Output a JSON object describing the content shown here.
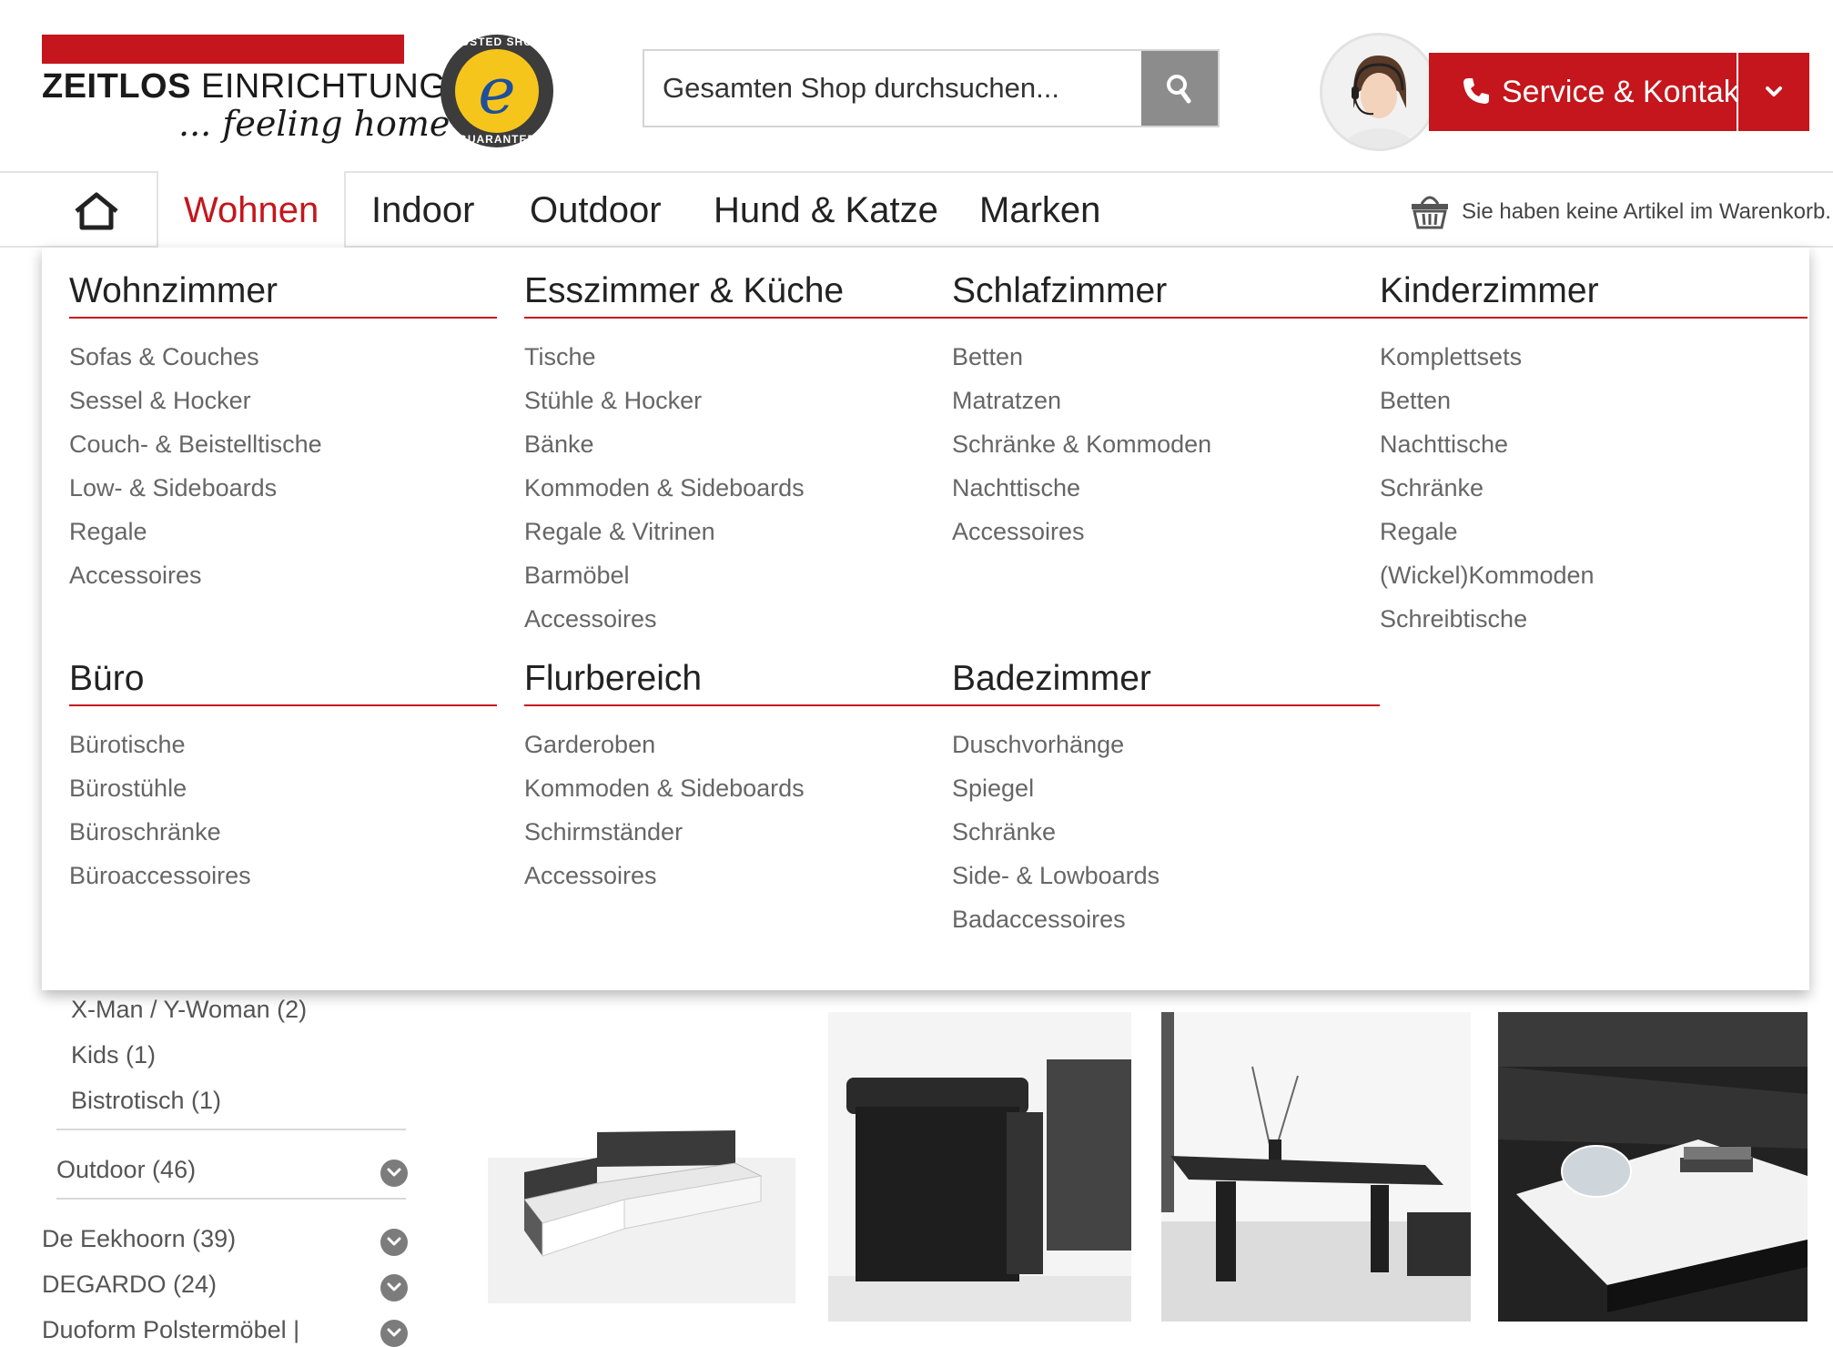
{
  "header": {
    "logo": {
      "brand_bold": "ZEITLOS",
      "brand_rest": "EINRICHTUNG",
      "tagline": "... feeling home"
    },
    "trust_badge": {
      "top_text": "TRUSTED SHOPS",
      "bottom_text": "GUARANTEE",
      "letter": "e"
    },
    "search": {
      "placeholder": "Gesamten Shop durchsuchen..."
    },
    "service": {
      "label": "Service & Kontakt"
    }
  },
  "nav": {
    "items": [
      "Wohnen",
      "Indoor",
      "Outdoor",
      "Hund & Katze",
      "Marken"
    ],
    "active": "Wohnen",
    "cart_text": "Sie haben keine Artikel im Warenkorb."
  },
  "mega_menu": {
    "columns_row1": [
      {
        "title": "Wohnzimmer",
        "links": [
          "Sofas & Couches",
          "Sessel & Hocker",
          "Couch- & Beistelltische",
          "Low- & Sideboards",
          "Regale",
          "Accessoires"
        ]
      },
      {
        "title": "Esszimmer & Küche",
        "links": [
          "Tische",
          "Stühle & Hocker",
          "Bänke",
          "Kommoden & Sideboards",
          "Regale & Vitrinen",
          "Barmöbel",
          "Accessoires"
        ]
      },
      {
        "title": "Schlafzimmer",
        "links": [
          "Betten",
          "Matratzen",
          "Schränke & Kommoden",
          "Nachttische",
          "Accessoires"
        ]
      },
      {
        "title": "Kinderzimmer",
        "links": [
          "Komplettsets",
          "Betten",
          "Nachttische",
          "Schränke",
          "Regale",
          "(Wickel)Kommoden",
          "Schreibtische"
        ]
      }
    ],
    "columns_row2": [
      {
        "title": "Büro",
        "links": [
          "Bürotische",
          "Bürostühle",
          "Büroschränke",
          "Büroaccessoires"
        ]
      },
      {
        "title": "Flurbereich",
        "links": [
          "Garderoben",
          "Kommoden & Sideboards",
          "Schirmständer",
          "Accessoires"
        ]
      },
      {
        "title": "Badezimmer",
        "links": [
          "Duschvorhänge",
          "Spiegel",
          "Schränke",
          "Side- & Lowboards",
          "Badaccessoires"
        ]
      }
    ]
  },
  "sidebar": {
    "sub_items": [
      "X-Man / Y-Woman (2)",
      "Kids (1)",
      "Bistrotisch (1)"
    ],
    "categories": [
      "Outdoor (46)",
      "De Eekhoorn (39)",
      "DEGARDO (24)",
      "Duoform Polstermöbel |"
    ]
  },
  "colors": {
    "accent": "#c4161c",
    "text": "#333333",
    "link": "#666666"
  }
}
